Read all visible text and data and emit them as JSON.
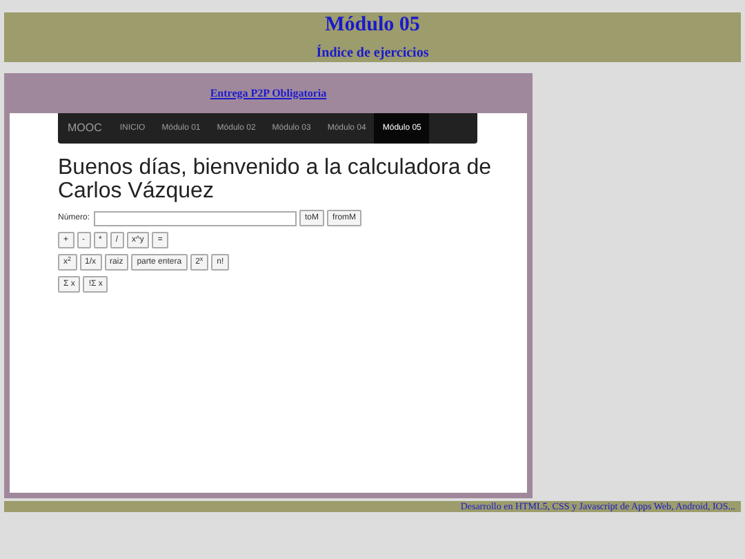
{
  "header": {
    "title": "Módulo 05",
    "subtitle": "Índice de ejercicios"
  },
  "panel": {
    "link": "Entrega P2P Obligatoria"
  },
  "navbar": {
    "brand": "MOOC",
    "items": [
      {
        "label": "INICIO",
        "selected": false
      },
      {
        "label": "Módulo 01",
        "selected": false
      },
      {
        "label": "Módulo 02",
        "selected": false
      },
      {
        "label": "Módulo 03",
        "selected": false
      },
      {
        "label": "Módulo 04",
        "selected": false
      },
      {
        "label": "Módulo 05",
        "selected": true
      }
    ]
  },
  "heading": "Buenos días, bienvenido a la calculadora de Carlos Vázquez",
  "number_field": {
    "label": "Número:"
  },
  "memory_buttons": [
    "toM",
    "fromM"
  ],
  "button_rows": [
    [
      "+",
      "-",
      "*",
      "/",
      "x^y",
      "="
    ],
    [
      "x$^{2}$",
      "1/x",
      "raiz",
      "parte entera",
      "2$^{x}$",
      "n!"
    ],
    [
      "Σ x",
      "!Σ x"
    ]
  ],
  "footer": "Desarrollo en HTML5, CSS y Javascript de Apps Web, Android, IOS..."
}
